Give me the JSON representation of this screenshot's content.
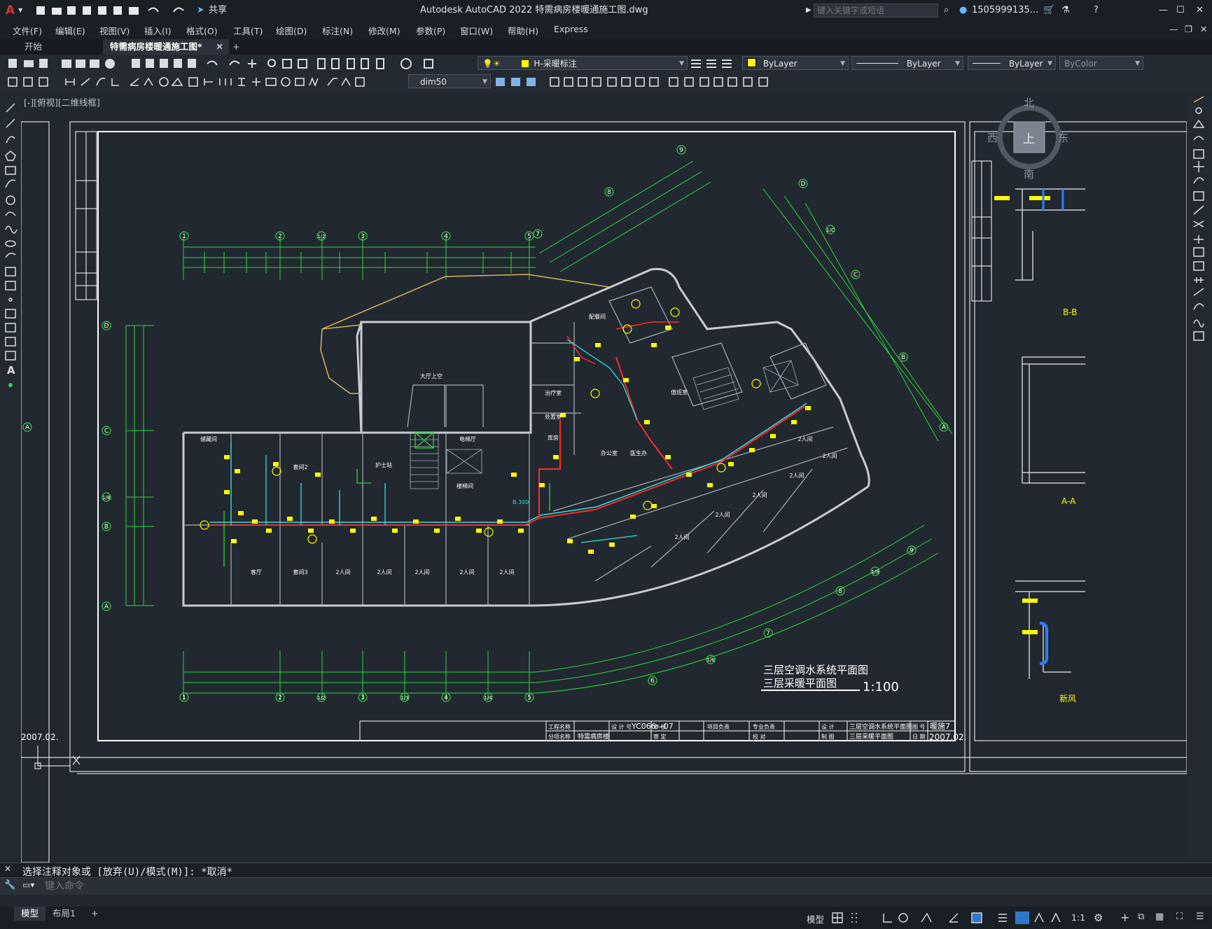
{
  "app": {
    "title": "Autodesk AutoCAD 2022    特需病房楼暖通施工图.dwg",
    "share_label": "共享",
    "search_placeholder": "键入关键字或短语",
    "user": "1505999135...",
    "app_letter": "A"
  },
  "menu": [
    "文件(F)",
    "编辑(E)",
    "视图(V)",
    "插入(I)",
    "格式(O)",
    "工具(T)",
    "绘图(D)",
    "标注(N)",
    "修改(M)",
    "参数(P)",
    "窗口(W)",
    "帮助(H)",
    "Express"
  ],
  "tabs": {
    "start": "开始",
    "drawing": "特需病房楼暖通施工图*",
    "add": "+"
  },
  "toolbar": {
    "layer_value": "H-采暖标注",
    "color_value": "ByLayer",
    "linetype_value": "ByLayer",
    "lineweight_value": "ByLayer",
    "plotstyle_value": "ByColor",
    "dimstyle_value": "dim50"
  },
  "viewport": {
    "label": "[-][俯视][二维线框]",
    "viewcube": {
      "north": "北",
      "south": "南",
      "east": "东",
      "west": "西",
      "top": "上"
    }
  },
  "drawing": {
    "title_line1": "三层空调水系统平面图",
    "title_line2": "三层采暖平面图",
    "scale": "1:100",
    "project_no": "YC066—07",
    "sheet_no": "暖施7",
    "date": "2007.02.",
    "left_date": "2007.02.",
    "titleblock_name1": "三层空调水系统平面图",
    "titleblock_name2": "三层采暖平面图",
    "titleblock_project": "特需病房楼",
    "titleblock_labels": [
      "工程名称",
      "设 计 号",
      "项目负责",
      "专业负责",
      "设 计",
      "分项名称",
      "审 核",
      "审 定",
      "校 对",
      "制 图",
      "图 号",
      "日 期"
    ],
    "axis_top": [
      "1",
      "2",
      "1/2",
      "3",
      "4",
      "5",
      "7",
      "8",
      "9"
    ],
    "axis_bottom": [
      "1",
      "2",
      "1/2",
      "3",
      "1/3",
      "4",
      "1/4",
      "5",
      "6",
      "1/6",
      "7",
      "8",
      "1/8",
      "9"
    ],
    "axis_left": [
      "D",
      "C",
      "1/B",
      "B",
      "A"
    ],
    "axis_right": [
      "D",
      "1/C",
      "C",
      "B",
      "A"
    ],
    "room_labels": [
      "大厅上空",
      "2人间",
      "2人间",
      "2人间",
      "2人间",
      "2人间",
      "2人间",
      "2人间",
      "2人间",
      "2人间",
      "2人间",
      "2人间",
      "客厅",
      "套间2",
      "套间3",
      "储藏间",
      "护士站",
      "电梯厅",
      "楼梯间",
      "配餐间",
      "治疗室",
      "处置室",
      "库房",
      "办公室",
      "医生办",
      "值班室"
    ],
    "side_labels": [
      "B-B",
      "A-A",
      "新风"
    ],
    "elevation_note": "B.300"
  },
  "command": {
    "history": "选择注释对象或 [放弃(U)/模式(M)]: *取消*",
    "placeholder": "键入命令"
  },
  "status": {
    "tab_model": "模型",
    "tab_layout": "布局1",
    "add": "+",
    "model_label": "模型",
    "scale_label": "1:1"
  }
}
